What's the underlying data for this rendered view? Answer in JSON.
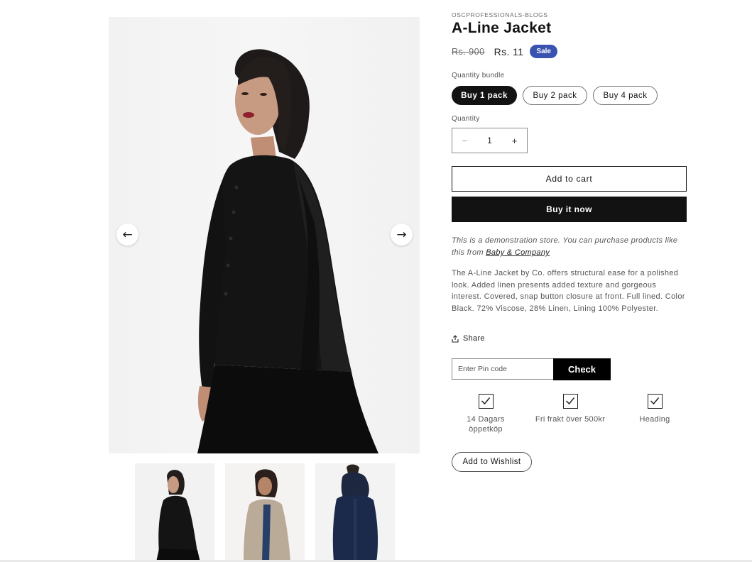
{
  "product": {
    "vendor": "OSCPROFESSIONALS-BLOGS",
    "title": "A-Line Jacket",
    "price_old": "Rs. 900",
    "price_new": "Rs. 11",
    "badge": "Sale",
    "badge_color": "#3a53b0"
  },
  "gallery": {
    "prev_icon": "←",
    "next_icon": "→",
    "thumbnails": [
      "black-jacket-thumbnail",
      "beige-coat-thumbnail",
      "navy-hooded-coat-thumbnail"
    ]
  },
  "bundle": {
    "label": "Quantity bundle",
    "options": [
      "Buy 1 pack",
      "Buy 2 pack",
      "Buy 4 pack"
    ],
    "selected": "Buy 1 pack"
  },
  "quantity": {
    "label": "Quantity",
    "minus": "−",
    "value": "1",
    "plus": "+"
  },
  "buttons": {
    "add_to_cart": "Add to cart",
    "buy_now": "Buy it now",
    "wishlist": "Add to Wishlist"
  },
  "note": {
    "text": "This is a demonstration store. You can purchase products like this from ",
    "link": "Baby & Company"
  },
  "description": "The A-Line Jacket by Co. offers structural ease for a polished look. Added linen presents added texture and gorgeous interest. Covered, snap button closure at front. Full lined. Color Black. 72% Viscose, 28% Linen, Lining 100% Polyester.",
  "share": {
    "label": "Share",
    "icon": "share-icon"
  },
  "pincode": {
    "placeholder": "Enter Pin code",
    "button": "Check"
  },
  "features": [
    {
      "icon": "checkbox-icon",
      "line1": "14 Dagars",
      "line2": "öppetköp"
    },
    {
      "icon": "checkbox-icon",
      "line1": "Fri frakt över 500kr",
      "line2": ""
    },
    {
      "icon": "checkbox-icon",
      "line1": "Heading",
      "line2": ""
    }
  ]
}
